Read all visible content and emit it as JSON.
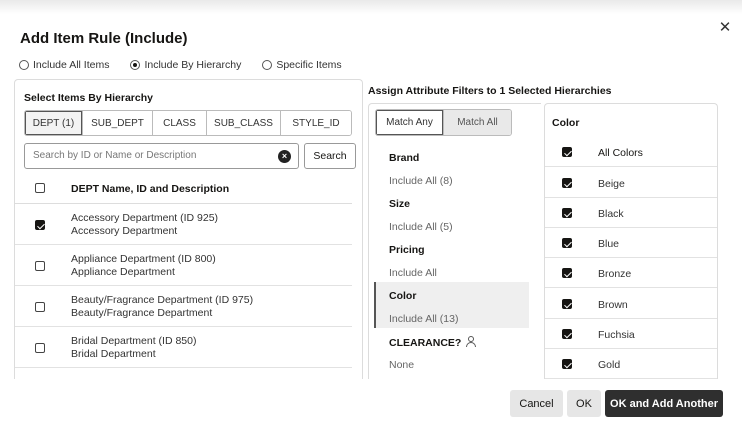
{
  "dialog": {
    "title": "Add Item Rule (Include)",
    "close_glyph": "✕"
  },
  "scope_options": [
    {
      "label": "Include All Items",
      "selected": false
    },
    {
      "label": "Include By Hierarchy",
      "selected": true
    },
    {
      "label": "Specific Items",
      "selected": false
    }
  ],
  "hierarchy": {
    "title": "Select Items By Hierarchy",
    "tabs": [
      {
        "label": "DEPT (1)",
        "active": true
      },
      {
        "label": "SUB_DEPT",
        "active": false
      },
      {
        "label": "CLASS",
        "active": false
      },
      {
        "label": "SUB_CLASS",
        "active": false
      },
      {
        "label": "STYLE_ID",
        "active": false
      }
    ],
    "search_placeholder": "Search by ID or Name or Description",
    "search_button": "Search",
    "list_header": "DEPT Name, ID and Description",
    "rows": [
      {
        "line1": "Accessory Department (ID 925)",
        "line2": "Accessory Department",
        "checked": true
      },
      {
        "line1": "Appliance Department (ID 800)",
        "line2": "Appliance Department",
        "checked": false
      },
      {
        "line1": "Beauty/Fragrance Department (ID 975)",
        "line2": "Beauty/Fragrance Department",
        "checked": false
      },
      {
        "line1": "Bridal Department (ID 850)",
        "line2": "Bridal Department",
        "checked": false
      }
    ]
  },
  "attributes": {
    "title": "Assign Attribute Filters to 1 Selected Hierarchies",
    "match_any": "Match Any",
    "match_all": "Match All",
    "items": [
      {
        "name": "Brand",
        "value": "Include All (8)",
        "selected": false
      },
      {
        "name": "Size",
        "value": "Include All (5)",
        "selected": false
      },
      {
        "name": "Pricing",
        "value": "Include All",
        "selected": false
      },
      {
        "name": "Color",
        "value": "Include All (13)",
        "selected": true
      },
      {
        "name": "CLEARANCE?",
        "value": "None",
        "selected": false
      }
    ]
  },
  "colors": {
    "title": "Color",
    "all_label": "All Colors",
    "items": [
      "Beige",
      "Black",
      "Blue",
      "Bronze",
      "Brown",
      "Fuchsia",
      "Gold"
    ]
  },
  "footer": {
    "cancel": "Cancel",
    "ok": "OK",
    "ok_add": "OK and Add Another"
  }
}
